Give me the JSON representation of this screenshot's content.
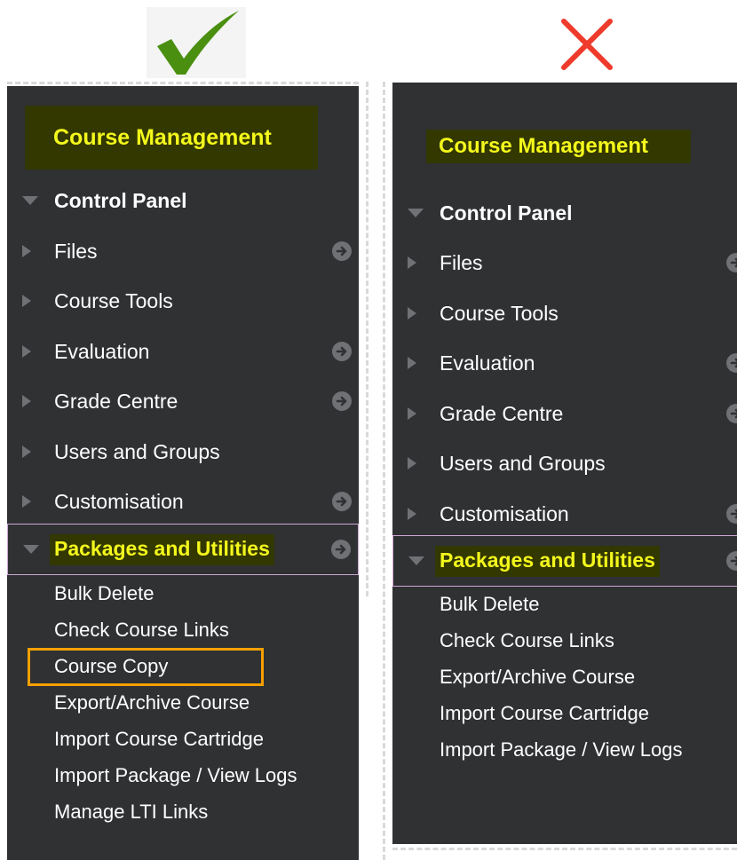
{
  "colors": {
    "panel_bg": "#2f3133",
    "highlight_bg": "#333800",
    "highlight_text": "#f4f81c",
    "check": "#4a8f10",
    "cross": "#ee3b2c",
    "callout": "#f5a000",
    "selected_border": "#cfa6d6"
  },
  "verdict": {
    "correct_icon": "check-mark-icon",
    "wrong_icon": "cross-mark-icon"
  },
  "left": {
    "header": "Course Management",
    "control_panel": "Control Panel",
    "items": [
      {
        "label": "Files",
        "arrow": true
      },
      {
        "label": "Course Tools",
        "arrow": false
      },
      {
        "label": "Evaluation",
        "arrow": true
      },
      {
        "label": "Grade Centre",
        "arrow": true
      },
      {
        "label": "Users and Groups",
        "arrow": false
      },
      {
        "label": "Customisation",
        "arrow": true
      }
    ],
    "packages": "Packages and Utilities",
    "subitems": [
      "Bulk Delete",
      "Check Course Links",
      "Course Copy",
      "Export/Archive Course",
      "Import Course Cartridge",
      "Import Package / View Logs",
      "Manage LTI Links"
    ]
  },
  "right": {
    "header": "Course Management",
    "control_panel": "Control Panel",
    "items": [
      {
        "label": "Files",
        "arrow": true
      },
      {
        "label": "Course Tools",
        "arrow": false
      },
      {
        "label": "Evaluation",
        "arrow": true
      },
      {
        "label": "Grade Centre",
        "arrow": true
      },
      {
        "label": "Users and Groups",
        "arrow": false
      },
      {
        "label": "Customisation",
        "arrow": true
      }
    ],
    "packages": "Packages and Utilities",
    "subitems": [
      "Bulk Delete",
      "Check Course Links",
      "Export/Archive Course",
      "Import Course Cartridge",
      "Import Package / View Logs"
    ]
  }
}
